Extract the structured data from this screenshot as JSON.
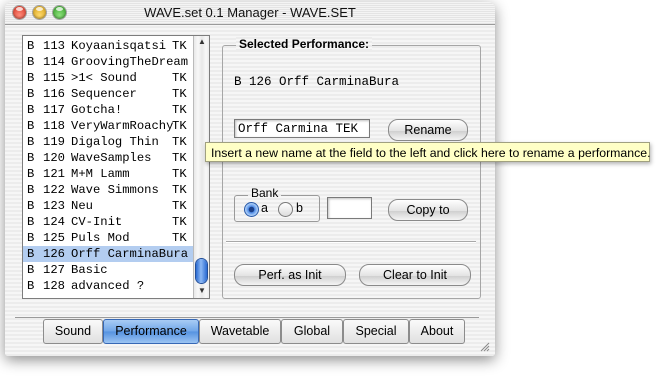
{
  "window": {
    "title": "WAVE.set 0.1 Manager - WAVE.SET"
  },
  "performance_list": [
    {
      "bank": "B",
      "num": "113",
      "name": "Koyaanisqatsi",
      "tag": "TK"
    },
    {
      "bank": "B",
      "num": "114",
      "name": "GroovingTheDream",
      "tag": ""
    },
    {
      "bank": "B",
      "num": "115",
      "name": ">1< Sound",
      "tag": "TK"
    },
    {
      "bank": "B",
      "num": "116",
      "name": "Sequencer",
      "tag": "TK"
    },
    {
      "bank": "B",
      "num": "117",
      "name": "Gotcha!",
      "tag": "TK"
    },
    {
      "bank": "B",
      "num": "118",
      "name": "VeryWarmRoachy",
      "tag": "TK"
    },
    {
      "bank": "B",
      "num": "119",
      "name": "Digalog Thin",
      "tag": "TK"
    },
    {
      "bank": "B",
      "num": "120",
      "name": "WaveSamples",
      "tag": "TK"
    },
    {
      "bank": "B",
      "num": "121",
      "name": "M+M Lamm",
      "tag": "TK"
    },
    {
      "bank": "B",
      "num": "122",
      "name": "Wave Simmons",
      "tag": "TK"
    },
    {
      "bank": "B",
      "num": "123",
      "name": "Neu",
      "tag": "TK"
    },
    {
      "bank": "B",
      "num": "124",
      "name": "CV-Init",
      "tag": "TK"
    },
    {
      "bank": "B",
      "num": "125",
      "name": "Puls Mod",
      "tag": "TK"
    },
    {
      "bank": "B",
      "num": "126",
      "name": "Orff CarminaBura",
      "tag": ""
    },
    {
      "bank": "B",
      "num": "127",
      "name": "Basic",
      "tag": ""
    },
    {
      "bank": "B",
      "num": "128",
      "name": "advanced ?",
      "tag": ""
    }
  ],
  "selected_index": 13,
  "scroll_position": 0.95,
  "panel": {
    "title": "Selected Performance:",
    "selected_text": "B 126 Orff CarminaBura",
    "name_field_value": "Orff Carmina TEK",
    "rename_button": "Rename",
    "tooltip": "Insert a new name at the field to the left and click here to rename a performance.",
    "bank_label": "Bank",
    "bank_options": [
      "a",
      "b"
    ],
    "bank_selected": "a",
    "copy_field_value": "",
    "copy_button": "Copy to",
    "perf_init_button": "Perf. as Init",
    "clear_init_button": "Clear to Init"
  },
  "tabs": [
    {
      "label": "Sound",
      "active": false
    },
    {
      "label": "Performance",
      "active": true
    },
    {
      "label": "Wavetable",
      "active": false
    },
    {
      "label": "Global",
      "active": false
    },
    {
      "label": "Special",
      "active": false
    },
    {
      "label": "About",
      "active": false
    }
  ],
  "colors": {
    "selection": "#b3cdf0",
    "tooltip_bg": "#ffffc6",
    "aqua_accent": "#5592e0"
  }
}
